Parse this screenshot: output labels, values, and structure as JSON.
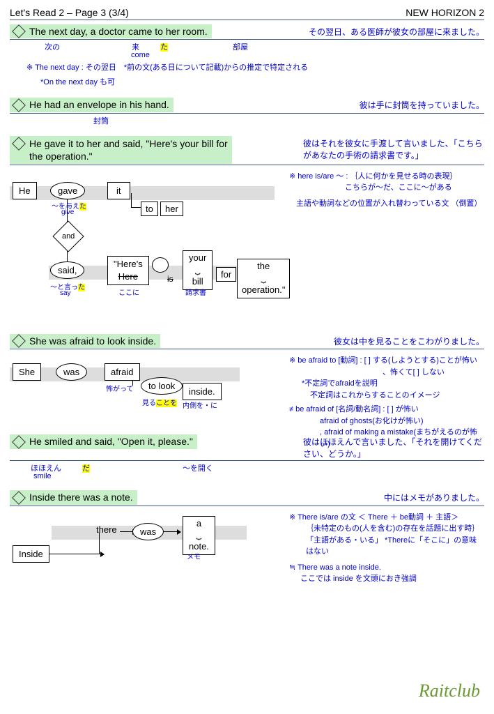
{
  "header": {
    "left": "Let's Read 2 – Page 3 (3/4)",
    "right": "NEW HORIZON 2"
  },
  "s1": {
    "en": "The next day, a doctor came to her room.",
    "jp": "その翌日、ある医師が彼女の部屋に来ました。",
    "gloss_next": "次の",
    "gloss_came": "来",
    "gloss_came_hl": "た",
    "gloss_come": "come",
    "gloss_room": "部屋",
    "note1": "※ The next day :  その翌日　*前の文(ある日について記載)からの推定で特定される",
    "note2": "*On the next day も可"
  },
  "s2": {
    "en": "He had an envelope in his hand.",
    "jp": "彼は手に封筒を持っていました。",
    "gloss_env": "封筒"
  },
  "s3": {
    "en_l1": "He gave it to her and said, \"Here's your bill for",
    "en_l2": "the operation.\"",
    "jp": "彼はそれを彼女に手渡して言いました、「こちらがあなたの手術の請求書です。」",
    "he": "He",
    "gave": "gave",
    "it": "it",
    "to": "to",
    "her": "her",
    "and": "and",
    "said": "said,",
    "heres": "\"Here's",
    "here_strike": "Here",
    "is_strike": "is",
    "your": "your",
    "bill": "bill",
    "for": "for",
    "the": "the",
    "operation": "operation.\"",
    "gloss_gave": "～を与え",
    "gloss_gave_hl": "た",
    "gloss_give": "give",
    "gloss_said": "～と言っ",
    "gloss_said_hl": "た",
    "gloss_say": "say",
    "gloss_here": "ここに",
    "gloss_bill": "請求書",
    "note1": "※ here is/are ～ :  ｛人に何かを見せる時の表現｝",
    "note2": "こちらが～だ、ここに～がある",
    "note3": "主語や動詞などの位置が入れ替わっている文 （倒置）"
  },
  "s4": {
    "en": "She was afraid to look inside.",
    "jp": "彼女は中を見ることをこわがりました。",
    "she": "She",
    "was": "was",
    "afraid": "afraid",
    "tolook": "to look",
    "inside": "inside.",
    "gloss_afraid": "怖がって",
    "gloss_look": "見る",
    "gloss_look_hl": "ことを",
    "gloss_inside": "内側を・に",
    "note1": "※ be afraid to [動詞] :  [  ] する(しようとする)ことが怖い",
    "note1b": "、怖くて[  ] しない",
    "note2": "*不定詞でafraidを説明",
    "note3": "不定詞はこれからすることのイメージ",
    "note4": "≠ be afraid of [名詞/動名詞] :  [  ] が怖い",
    "note5": "afraid of ghosts(お化けが怖い)",
    "note6": ", afraid of making a mistake(まちがえるのが怖い)"
  },
  "s5": {
    "en": "He smiled and said, \"Open it, please.\"",
    "jp": "彼はほほえんで言いました、「それを開けてください、どうか。」",
    "gloss_smiled": "ほほえん",
    "gloss_smiled_hl": "だ",
    "gloss_smile": "smile",
    "gloss_open": "～を開く"
  },
  "s6": {
    "en": "Inside there was a note.",
    "jp": "中にはメモがありました。",
    "inside": "Inside",
    "there": "there",
    "was": "was",
    "a": "a",
    "note": "note.",
    "gloss_note": "メモ",
    "note1": "※ There is/are の文  ＜ There ＋ be動詞 ＋ 主語＞",
    "note2": "｛未特定のもの(人を含む)の存在を話題に出す時｝",
    "note3": "「主語がある・いる」 *Thereに「そこに」の意味はない",
    "note4": "≒ There was a note inside.",
    "note5": "ここでは inside を文頭におき強調"
  },
  "watermark": "Raitclub"
}
